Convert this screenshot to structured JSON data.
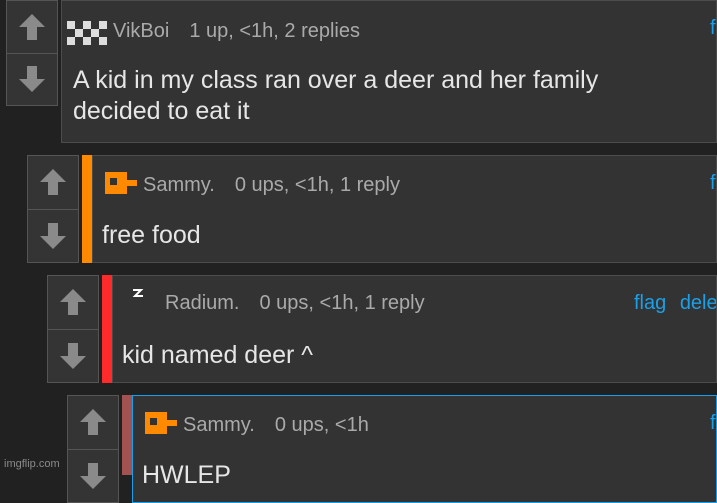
{
  "comments": [
    {
      "username": "VikBoi",
      "meta": "1 up, <1h, 2 replies",
      "text_lines": [
        "A kid in my class ran over a deer and her family",
        "decided to eat it"
      ],
      "actions": [
        "f"
      ],
      "stripe_color": null,
      "avatar_icon": "pixel-checker-icon"
    },
    {
      "username": "Sammy.",
      "meta": "0 ups, <1h, 1 reply",
      "text_lines": [
        "free food"
      ],
      "actions": [
        "f"
      ],
      "stripe_color": "#ff8a00",
      "avatar_icon": "orange-pixel-avatar-icon"
    },
    {
      "username": "Radium.",
      "meta": "0 ups, <1h, 1 reply",
      "text_lines": [
        "kid named deer ^"
      ],
      "actions": [
        "flag",
        "dele"
      ],
      "stripe_color": "#ff2a2a",
      "avatar_icon": "lightning-icon"
    },
    {
      "username": "Sammy.",
      "meta": "0 ups, <1h",
      "text_lines": [
        "HWLEP"
      ],
      "actions": [
        "f"
      ],
      "stripe_color": "#a35252",
      "avatar_icon": "orange-pixel-avatar-icon"
    }
  ],
  "watermark": "imgflip.com",
  "colors": {
    "background": "#212121",
    "panel": "#333333",
    "link": "#1aa0e8",
    "meta_text": "#aaaaaa",
    "body_text": "#e6e6e6"
  }
}
